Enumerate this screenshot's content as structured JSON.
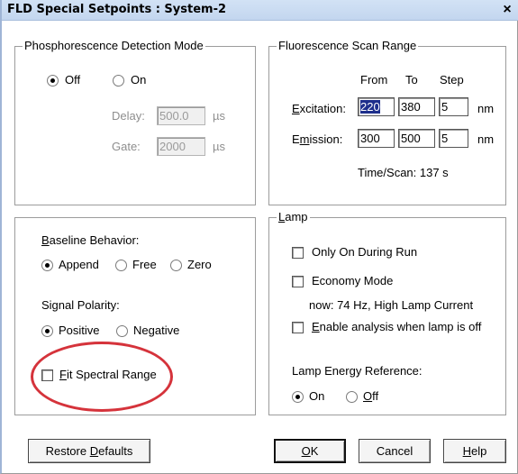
{
  "window": {
    "title": "FLD Special Setpoints : System-2",
    "close_label": "×"
  },
  "phosphorescence": {
    "group_title": "Phosphorescence Detection Mode",
    "off_label": "Off",
    "on_label": "On",
    "selected": "Off",
    "delay_label": "Delay:",
    "delay_value": "500.0",
    "delay_unit": "µs",
    "gate_label": "Gate:",
    "gate_value": "2000",
    "gate_unit": "µs"
  },
  "scan_range": {
    "group_title": "Fluorescence Scan Range",
    "col_from": "From",
    "col_to": "To",
    "col_step": "Step",
    "excitation_label": "Excitation:",
    "excitation_from": "220",
    "excitation_to": "380",
    "excitation_step": "5",
    "emission_label": "Emission:",
    "emission_from": "300",
    "emission_to": "500",
    "emission_step": "5",
    "unit": "nm",
    "time_scan": "Time/Scan: 137 s"
  },
  "baseline": {
    "label": "Baseline Behavior:",
    "options": [
      "Append",
      "Free",
      "Zero"
    ],
    "selected": "Append"
  },
  "polarity": {
    "label": "Signal Polarity:",
    "options": [
      "Positive",
      "Negative"
    ],
    "selected": "Positive"
  },
  "fit_spectral": {
    "label": "Fit Spectral Range",
    "checked": false
  },
  "lamp": {
    "group_title": "Lamp",
    "only_on_label": "Only On During Run",
    "economy_label": "Economy Mode",
    "economy_note": "now: 74 Hz, High Lamp Current",
    "enable_analysis_label": "Enable analysis when lamp is off",
    "energy_ref_label": "Lamp Energy Reference:",
    "energy_on": "On",
    "energy_off": "Off",
    "energy_selected": "On"
  },
  "buttons": {
    "restore": "Restore Defaults",
    "ok": "OK",
    "cancel": "Cancel",
    "help": "Help"
  },
  "colors": {
    "highlight_circle": "#d5333b",
    "selection": "#1e2f8c"
  }
}
